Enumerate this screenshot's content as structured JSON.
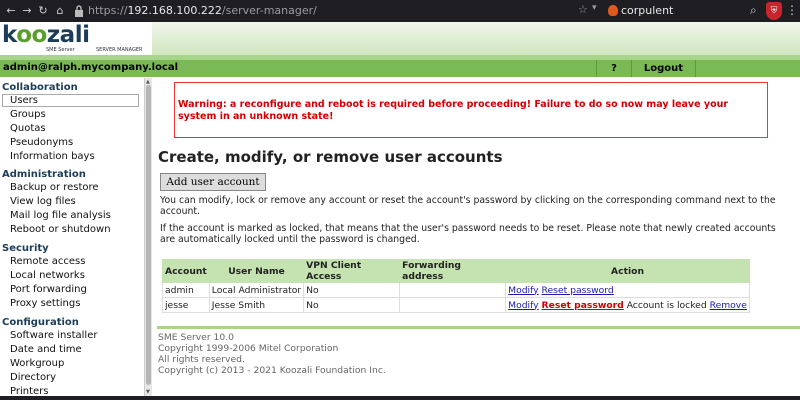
{
  "browser": {
    "url_scheme": "https://",
    "url_host": "192.168.100.222",
    "url_path": "/server-manager/",
    "search_text": "corpulent",
    "icons": [
      "back-icon",
      "forward-icon",
      "reload-icon",
      "home-icon",
      "lock-icon",
      "star-icon",
      "dropdown-icon",
      "search-icon",
      "ublock-icon",
      "menu-icon"
    ]
  },
  "header": {
    "logo_pre": "k",
    "logo_oo": "oo",
    "logo_post": "zali",
    "logo_sub": "SME Server",
    "logo_sub2": "SERVER MANAGER"
  },
  "user_bar": {
    "user": "admin@ralph.mycompany.local",
    "help": "?",
    "logout": "Logout"
  },
  "sidebar": {
    "sections": [
      {
        "heading": "Collaboration",
        "items": [
          "Users",
          "Groups",
          "Quotas",
          "Pseudonyms",
          "Information bays"
        ]
      },
      {
        "heading": "Administration",
        "items": [
          "Backup or restore",
          "View log files",
          "Mail log file analysis",
          "Reboot or shutdown"
        ]
      },
      {
        "heading": "Security",
        "items": [
          "Remote access",
          "Local networks",
          "Port forwarding",
          "Proxy settings"
        ]
      },
      {
        "heading": "Configuration",
        "items": [
          "Software installer",
          "Date and time",
          "Workgroup",
          "Directory",
          "Printers"
        ]
      }
    ],
    "active": "Users"
  },
  "main": {
    "warning": "Warning: a reconfigure and reboot is required before proceeding! Failure to do so now may leave your system in an unknown state!",
    "title": "Create, modify, or remove user accounts",
    "add_button": "Add user account",
    "para1": "You can modify, lock or remove any account or reset the account's password by clicking on the corresponding command next to the account.",
    "para2": "If the account is marked as locked, that means that the user's password needs to be reset. Please note that newly created accounts are automatically locked until the password is changed.",
    "table": {
      "headers": [
        "Account",
        "User Name",
        "VPN Client Access",
        "Forwarding address",
        "Action"
      ],
      "rows": [
        {
          "account": "admin",
          "user_name": "Local Administrator",
          "vpn": "No",
          "forwarding": "",
          "modify": "Modify",
          "reset": "Reset password",
          "status": "",
          "remove": ""
        },
        {
          "account": "jesse",
          "user_name": "Jesse Smith",
          "vpn": "No",
          "forwarding": "",
          "modify": "Modify",
          "reset": "Reset password",
          "status": "Account is locked",
          "remove": "Remove"
        }
      ]
    }
  },
  "footer": {
    "line1": "SME Server 10.0",
    "line2": "Copyright 1999-2006 Mitel Corporation",
    "line3": "All rights reserved.",
    "line4": "Copyright (c) 2013 - 2021 Koozali Foundation Inc."
  },
  "colors": {
    "accent_green": "#7ab956",
    "table_header": "#c5e3b0",
    "warning_red": "#d40000",
    "logo_blue": "#1d3c59"
  }
}
